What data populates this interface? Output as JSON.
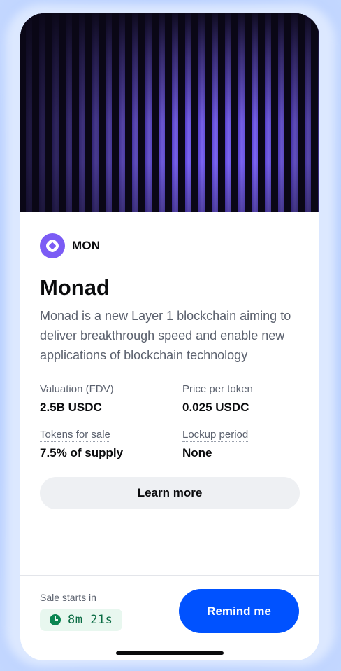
{
  "token": {
    "symbol": "MON",
    "name": "Monad",
    "description": "Monad is a new Layer 1 blockchain aiming to deliver breakthrough speed and enable new applications of blockchain technology",
    "logo_icon": "monad-logo-icon",
    "logo_color": "#7b5cf5"
  },
  "stats": [
    {
      "label": "Valuation (FDV)",
      "value": "2.5B USDC"
    },
    {
      "label": "Price per token",
      "value": "0.025 USDC"
    },
    {
      "label": "Tokens for sale",
      "value": "7.5% of supply"
    },
    {
      "label": "Lockup period",
      "value": "None"
    }
  ],
  "actions": {
    "learn_more_label": "Learn more",
    "remind_label": "Remind me"
  },
  "sale": {
    "label": "Sale starts in",
    "countdown": "8m 21s",
    "clock_icon": "clock-icon"
  },
  "colors": {
    "primary": "#0052ff",
    "countdown_bg": "#e8f7ef",
    "countdown_fg": "#0a6b43",
    "hero_stripe": "#7d67f2"
  }
}
